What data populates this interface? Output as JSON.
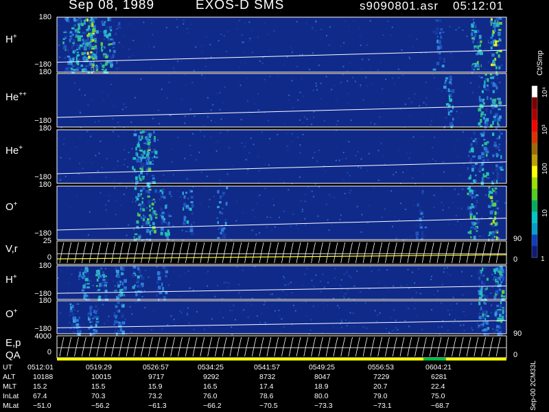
{
  "header": {
    "date": "Sep 08, 1989",
    "instrument": "EXOS-D SMS",
    "file": "s9090801.asr",
    "time": "05:12:01"
  },
  "colors": {
    "background": "#000000",
    "spectrogram_bg": "#102a8a",
    "trace": "#ffffff",
    "velocity_curve": "#ffff40",
    "qa_bar": "#ffff00",
    "qa_flag": "#00c040"
  },
  "chart_data": {
    "type": "heatmap",
    "panels": [
      {
        "id": "H+",
        "label": "H",
        "sup": "+",
        "tick_top": "180",
        "tick_bottom": "−180",
        "ylim": [
          -180,
          180
        ],
        "hot_spots": [
          [
            0.6,
            130
          ],
          [
            1.0,
            140
          ],
          [
            1.3,
            150
          ],
          [
            1.8,
            200
          ],
          [
            2.0,
            220
          ],
          [
            2.8,
            170
          ],
          [
            3.3,
            60
          ],
          [
            22.0,
            90
          ],
          [
            24.2,
            180
          ],
          [
            25.3,
            220
          ]
        ]
      },
      {
        "id": "He++",
        "label": "He",
        "sup": "++",
        "tick_top": "180",
        "tick_bottom": "−180",
        "ylim": [
          -180,
          180
        ],
        "hot_spots": [
          [
            22.6,
            120
          ],
          [
            24.6,
            150
          ],
          [
            25.3,
            160
          ]
        ]
      },
      {
        "id": "He+",
        "label": "He",
        "sup": "+",
        "tick_top": "180",
        "tick_bottom": "−180",
        "ylim": [
          -180,
          180
        ],
        "hot_spots": [
          [
            4.6,
            120
          ],
          [
            5.0,
            180
          ],
          [
            5.4,
            130
          ],
          [
            24.0,
            110
          ],
          [
            24.6,
            140
          ],
          [
            25.4,
            120
          ]
        ]
      },
      {
        "id": "O+",
        "label": "O",
        "sup": "+",
        "tick_top": "180",
        "tick_bottom": "−180",
        "ylim": [
          -180,
          180
        ],
        "hot_spots": [
          [
            4.7,
            160
          ],
          [
            5.4,
            170
          ],
          [
            6.2,
            140
          ],
          [
            7.5,
            110
          ],
          [
            9.5,
            90
          ],
          [
            21.0,
            70
          ],
          [
            24.0,
            160
          ],
          [
            25.2,
            190
          ]
        ]
      },
      {
        "id": "H+ (2)",
        "label": "H",
        "sup": "+",
        "tick_top": "180",
        "tick_bottom": "−180",
        "ylim": [
          -180,
          180
        ],
        "hot_spots": [
          [
            1.5,
            120
          ],
          [
            2.5,
            130
          ],
          [
            3.6,
            140
          ],
          [
            4.6,
            120
          ],
          [
            6.0,
            90
          ],
          [
            24.6,
            150
          ],
          [
            25.5,
            160
          ]
        ]
      },
      {
        "id": "O+ (2)",
        "label": "O",
        "sup": "+",
        "tick_top": "180",
        "tick_bottom": "−180",
        "ylim": [
          -180,
          180
        ],
        "hot_spots": [
          [
            1.0,
            100
          ],
          [
            2.0,
            110
          ],
          [
            3.5,
            100
          ],
          [
            24.6,
            140
          ],
          [
            25.5,
            150
          ]
        ]
      }
    ],
    "line_panels": [
      {
        "id": "V,r",
        "label": "V,r",
        "tick_top": "25",
        "tick_mid": "0",
        "right_top": "90",
        "right_bottom": "0"
      },
      {
        "id": "E,p",
        "label": "E,p",
        "label2": "QA",
        "tick_top": "4000",
        "tick_mid": "0",
        "right_top": "90",
        "right_bottom": "0"
      }
    ],
    "colorbar": {
      "unit": "Ct/Smp",
      "tick_labels": [
        "1",
        "10",
        "100",
        "10³",
        "10⁴"
      ],
      "tick_values": [
        1,
        10,
        100,
        1000,
        10000
      ],
      "colors": [
        "#0d1a7a",
        "#0d3fbf",
        "#00a0d0",
        "#00c8c8",
        "#00b060",
        "#50d020",
        "#a0e000",
        "#ffff00",
        "#c0a000",
        "#a06a00",
        "#e03000",
        "#ff0000",
        "#b00000",
        "#800000",
        "#ffffff"
      ]
    }
  },
  "axis_table": {
    "rows": [
      {
        "label": "UT",
        "values": [
          "0512:01",
          "0519:29",
          "0526:57",
          "0534:25",
          "0541:57",
          "0549:25",
          "0556:53",
          "0604:21"
        ]
      },
      {
        "label": "ALT",
        "values": [
          "10188",
          "10015",
          "9717",
          "9292",
          "8732",
          "8047",
          "7229",
          "6281"
        ]
      },
      {
        "label": "MLT",
        "values": [
          "15.2",
          "15.5",
          "15.9",
          "16.5",
          "17.4",
          "18.9",
          "20.7",
          "22.4"
        ]
      },
      {
        "label": "InLat",
        "values": [
          "67.4",
          "70.3",
          "73.2",
          "76.0",
          "78.6",
          "80.0",
          "79.0",
          "75.0"
        ]
      },
      {
        "label": "MLat",
        "values": [
          "−51.0",
          "−56.2",
          "−61.3",
          "−66.2",
          "−70.5",
          "−73.3",
          "−73.1",
          "−68.7"
        ]
      }
    ]
  },
  "footer": "Sep-00  2CM33L"
}
